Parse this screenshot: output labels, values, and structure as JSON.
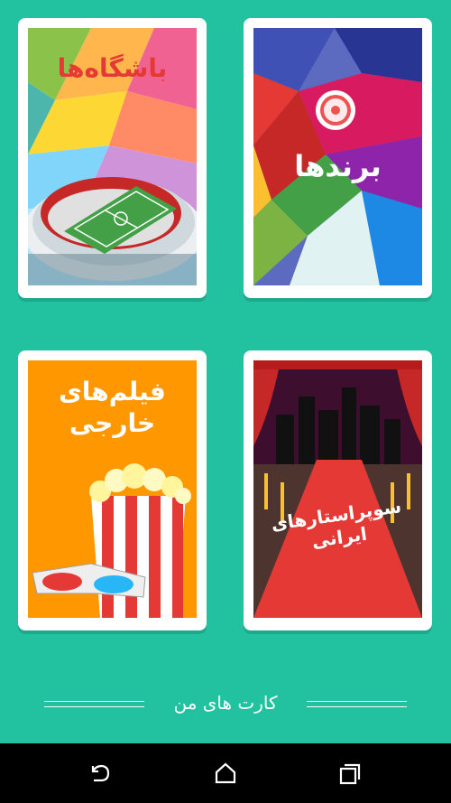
{
  "cards": {
    "clubs": {
      "title": "باشگاه‌ها",
      "color": "#e53935"
    },
    "brands": {
      "title": "برندها",
      "color": "#ffffff"
    },
    "movies": {
      "title_line1": "فیلم‌های",
      "title_line2": "خارجی",
      "color": "#ffffff"
    },
    "stars": {
      "title_line1": "سوپراستارهای",
      "title_line2": "ایرانی",
      "color": "#ffffff"
    }
  },
  "footer": {
    "label": "کارت های من"
  },
  "navbar": {
    "back_icon": "back-icon",
    "home_icon": "home-icon",
    "recents_icon": "recents-icon"
  },
  "colors": {
    "background": "#22c1a0",
    "movies_bg": "#ff9800",
    "stars_bg": "#e53935"
  }
}
